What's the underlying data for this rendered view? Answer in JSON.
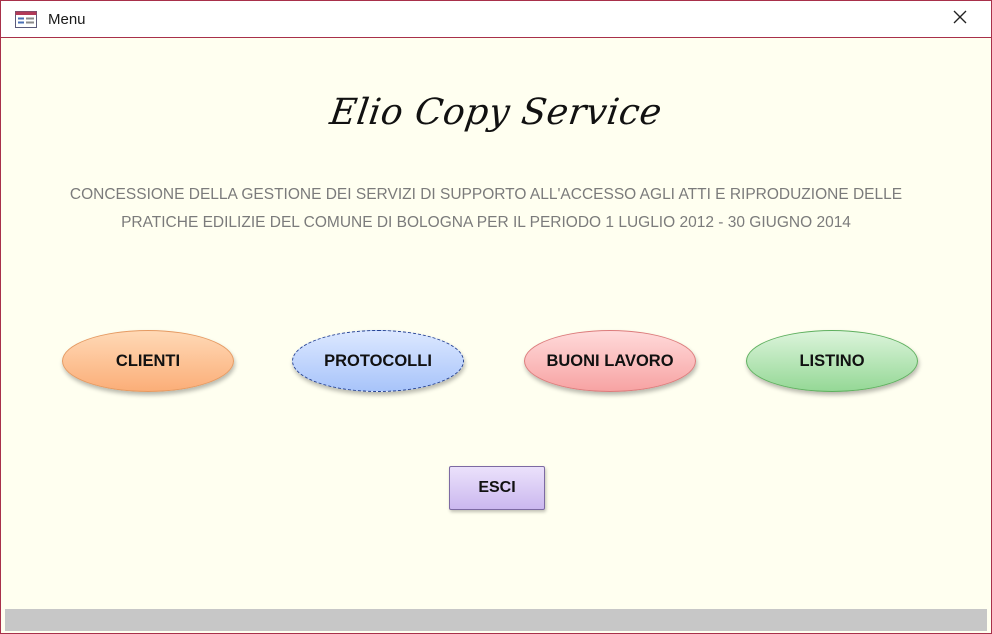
{
  "window": {
    "title": "Menu",
    "icon": "form-icon",
    "close_icon": "close-icon"
  },
  "header": {
    "brand": "Elio Copy Service",
    "description_line1": "CONCESSIONE DELLA GESTIONE DEI SERVIZI DI SUPPORTO ALL'ACCESSO AGLI ATTI E RIPRODUZIONE DELLE",
    "description_line2": "PRATICHE EDILIZIE DEL COMUNE DI BOLOGNA PER IL PERIODO 1 LUGLIO 2012 - 30 GIUGNO 2014"
  },
  "menu": {
    "buttons": [
      {
        "label": "CLIENTI",
        "color": "#fbae78"
      },
      {
        "label": "PROTOCOLLI",
        "color": "#a8c4fa"
      },
      {
        "label": "BUONI LAVORO",
        "color": "#f7a3a3"
      },
      {
        "label": "LISTINO",
        "color": "#95d896"
      }
    ],
    "exit_label": "ESCI",
    "exit_color": "#cbb8ef"
  },
  "colors": {
    "window_border": "#a8304a",
    "background": "#fffff0",
    "description_text": "#7b7b7b"
  }
}
